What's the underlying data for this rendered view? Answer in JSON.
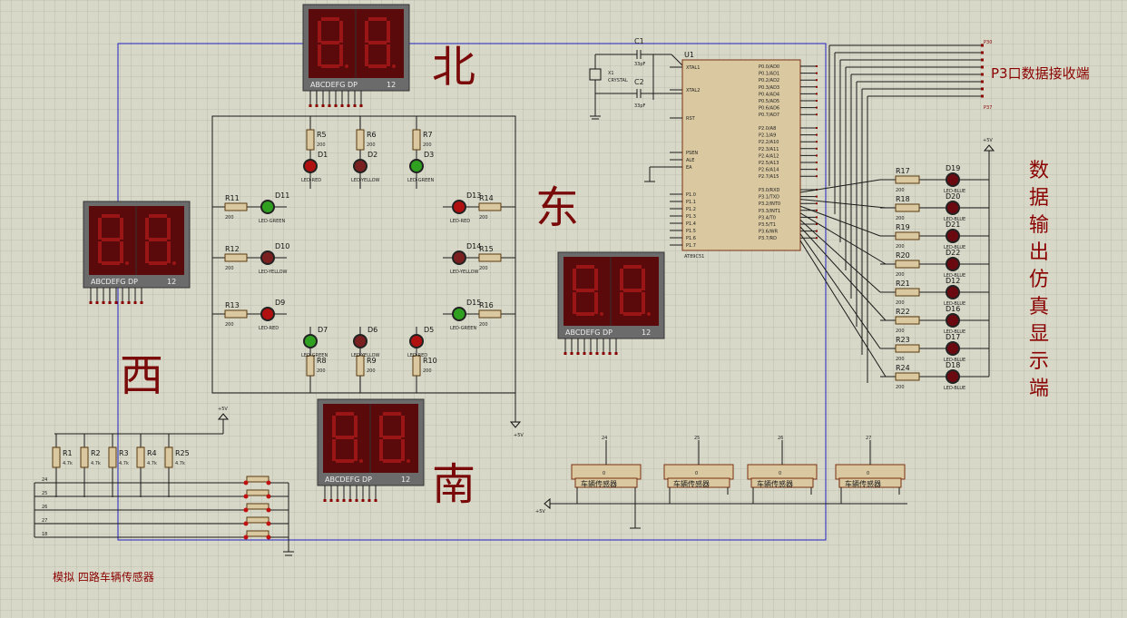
{
  "directions": {
    "north": "北",
    "east": "东",
    "west": "西",
    "south": "南"
  },
  "titles": {
    "p3_receiver": "P3口数据接收端",
    "data_output": "数据输出仿真显示端",
    "sensor_sim": "模拟 四路车辆传感器"
  },
  "display_label": "ABCDEFG  DP",
  "display_pins": "12",
  "mcu": {
    "ref": "U1",
    "part": "AT89C51",
    "left_pins": [
      "XTAL1",
      "XTAL2",
      "RST",
      "PSEN",
      "ALE",
      "EA",
      "P1.0",
      "P1.1",
      "P1.2",
      "P1.3",
      "P1.4",
      "P1.5",
      "P1.6",
      "P1.7"
    ],
    "right_pins": [
      "P0.0/AD0",
      "P0.1/AD1",
      "P0.2/AD2",
      "P0.3/AD3",
      "P0.4/AD4",
      "P0.5/AD5",
      "P0.6/AD6",
      "P0.7/AD7",
      "P2.0/A8",
      "P2.1/A9",
      "P2.2/A10",
      "P2.3/A11",
      "P2.4/A12",
      "P2.5/A13",
      "P2.6/A14",
      "P2.7/A15",
      "P3.0/RXD",
      "P3.1/TXD",
      "P3.2/INT0",
      "P3.3/INT1",
      "P3.4/T0",
      "P3.5/T1",
      "P3.6/WR",
      "P3.7/RD"
    ]
  },
  "crystal": {
    "ref": "X1",
    "label": "CRYSTAL",
    "c1": "C1",
    "c2": "C2",
    "cval": "33pF"
  },
  "vcc": "+5V",
  "port_labels": {
    "p30": "P30",
    "p37": "P37"
  },
  "traffic_leds": [
    {
      "ref": "D1",
      "type": "LED-RED"
    },
    {
      "ref": "D2",
      "type": "LED-YELLOW"
    },
    {
      "ref": "D3",
      "type": "LED-GREEN"
    },
    {
      "ref": "D11",
      "type": "LED-GREEN"
    },
    {
      "ref": "D10",
      "type": "LED-YELLOW"
    },
    {
      "ref": "D9",
      "type": "LED-RED"
    },
    {
      "ref": "D13",
      "type": "LED-RED"
    },
    {
      "ref": "D14",
      "type": "LED-YELLOW"
    },
    {
      "ref": "D15",
      "type": "LED-GREEN"
    },
    {
      "ref": "D7",
      "type": "LED-GREEN"
    },
    {
      "ref": "D6",
      "type": "LED-YELLOW"
    },
    {
      "ref": "D5",
      "type": "LED-RED"
    }
  ],
  "traffic_res": [
    "R5",
    "R6",
    "R7",
    "R11",
    "R12",
    "R13",
    "R14",
    "R15",
    "R16",
    "R8",
    "R9",
    "R10"
  ],
  "res_val": "200",
  "out_res": [
    "R17",
    "R18",
    "R19",
    "R20",
    "R21",
    "R22",
    "R23",
    "R24"
  ],
  "out_leds": [
    "D19",
    "D20",
    "D21",
    "D22",
    "D12",
    "D16",
    "D17",
    "D18"
  ],
  "out_led_type": "LED-BLUE",
  "pullups": [
    {
      "ref": "R1",
      "val": "4.7k"
    },
    {
      "ref": "R2",
      "val": "4.7k"
    },
    {
      "ref": "R3",
      "val": "4.7k"
    },
    {
      "ref": "R4",
      "val": "4.7k"
    },
    {
      "ref": "R25",
      "val": "4.7k"
    }
  ],
  "sensor_nets": [
    "24",
    "25",
    "26",
    "27",
    "18"
  ],
  "sensors": [
    "车辆传感器",
    "车辆传感器",
    "车辆传感器",
    "车辆传感器"
  ],
  "sensor_refs": [
    "24",
    "25",
    "26",
    "27"
  ]
}
